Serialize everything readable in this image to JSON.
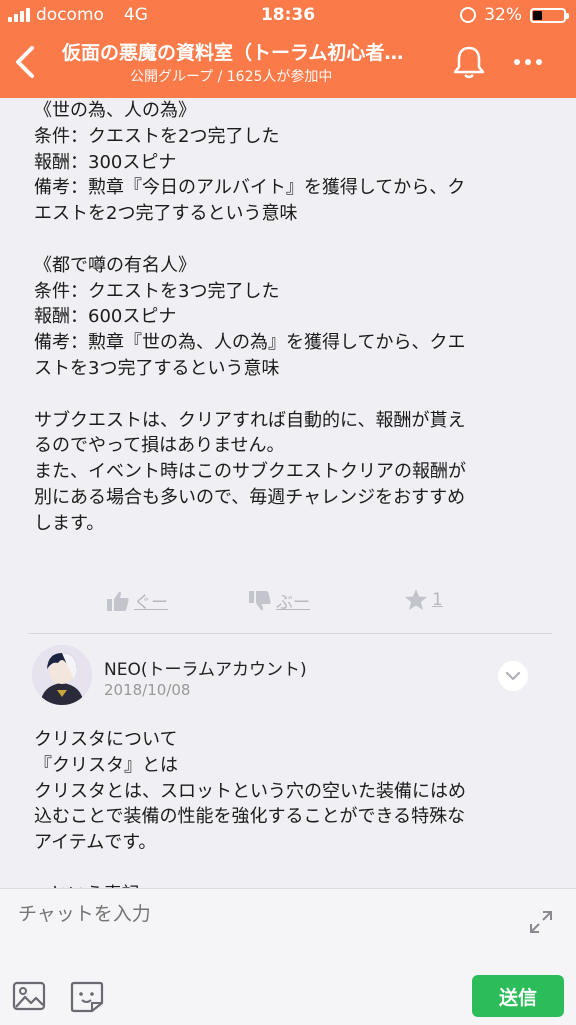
{
  "status_bar": {
    "carrier": "docomo",
    "network": "4G",
    "time": "18:36",
    "battery": "32%"
  },
  "header": {
    "title": "仮面の悪魔の資料室（トーラム初心者…",
    "subtitle": "公開グループ / 1625人が参加中",
    "accent_color": "#fb7a4a"
  },
  "post": {
    "text": "《世の為、人の為》\n条件：クエストを2つ完了した\n報酬：300スピナ\n備考：勲章『今日のアルバイト』を獲得してから、ク\nエストを2つ完了するという意味\n\n《都で噂の有名人》\n条件：クエストを3つ完了した\n報酬：600スピナ\n備考：勲章『世の為、人の為』を獲得してから、クエ\nストを3つ完了するという意味\n\nサブクエストは、クリアすれば自動的に、報酬が貰え\nるのでやって損はありません。\nまた、イベント時はこのサブクエストクリアの報酬が\n別にある場合も多いので、毎週チャレンジをおすすめ\nします。",
    "actions": {
      "good": "ぐー",
      "boo": "ぶー",
      "star_count": "1"
    }
  },
  "comment": {
    "author": "NEO(トーラムアカウント)",
    "date": "2018/10/08",
    "text": "クリスタについて\n『クリスタ』とは\nクリスタとは、スロットという穴の空いた装備にはめ\n込むことで装備の性能を強化することができる特殊な\nアイテムです。\n\n○という表記"
  },
  "input_bar": {
    "placeholder": "チャットを入力",
    "send_label": "送信",
    "send_color": "#2dbc5a"
  }
}
